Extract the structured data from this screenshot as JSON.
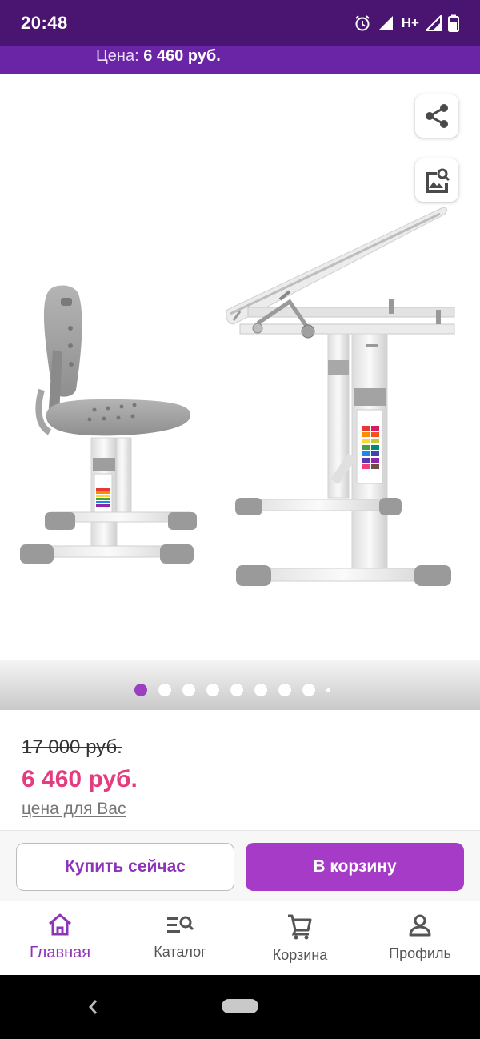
{
  "status_bar": {
    "time": "20:48",
    "network_label": "H+",
    "icons": [
      "alarm-icon",
      "signal-icon",
      "signal-icon",
      "battery-icon"
    ]
  },
  "price_bar": {
    "label": "Цена:",
    "value": "6 460 руб."
  },
  "gallery": {
    "image_name": "product-photo-desk-and-chair",
    "dot_count": 8,
    "active_dot": 0,
    "share_icon": "share-icon",
    "zoom_icon": "image-search-icon"
  },
  "prices": {
    "old_price": "17 000 руб.",
    "new_price": "6 460 руб.",
    "note": "цена для Вас"
  },
  "actions": {
    "buy_now": "Купить сейчас",
    "add_to_cart": "В корзину"
  },
  "bottom_nav": {
    "items": [
      {
        "label": "Главная",
        "icon": "home-icon",
        "active": true
      },
      {
        "label": "Каталог",
        "icon": "catalog-search-icon",
        "active": false
      },
      {
        "label": "Корзина",
        "icon": "cart-icon",
        "active": false
      },
      {
        "label": "Профиль",
        "icon": "person-icon",
        "active": false
      }
    ]
  },
  "colors": {
    "status_bar": "#4a1570",
    "accent": "#a53bc6",
    "price_highlight": "#e33d7f"
  }
}
